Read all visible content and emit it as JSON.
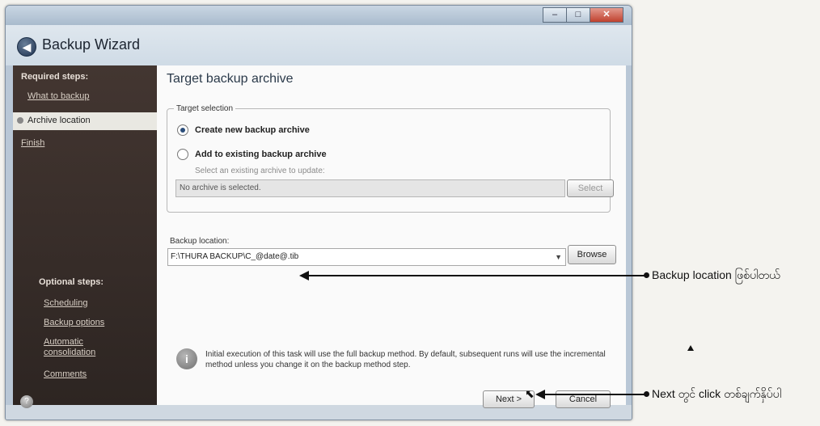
{
  "window": {
    "title": "Backup Wizard",
    "controls": {
      "minimize": "–",
      "maximize": "□",
      "close": "✕"
    }
  },
  "sidebar": {
    "required_heading": "Required steps:",
    "required_items": [
      "What to backup",
      "Archive location",
      "Finish"
    ],
    "active_item": "Archive location",
    "optional_heading": "Optional steps:",
    "optional_items": [
      "Scheduling",
      "Backup options",
      "Automatic",
      "consolidation",
      "Comments"
    ]
  },
  "main": {
    "title": "Target backup archive",
    "target_selection": {
      "legend": "Target selection",
      "option_new": "Create new backup archive",
      "option_existing": "Add to existing backup archive",
      "selected": "Create new backup archive",
      "hint": "Select an existing archive to update:",
      "archive_value": "No archive is selected.",
      "select_button": "Select"
    },
    "backup_location": {
      "label": "Backup location:",
      "value": "F:\\THURA BACKUP\\C_@date@.tib",
      "browse_button": "Browse"
    },
    "info_text": "Initial execution of this task will use the full backup method. By default, subsequent runs will use the incremental method unless you change it on the backup method step."
  },
  "footer": {
    "next_button": "Next >",
    "cancel_button": "Cancel"
  },
  "annotations": {
    "location_note": "Backup location ဖြစ်ပါတယ်",
    "next_note": "Next တွင် click တစ်ချက်နှိပ်ပါ"
  }
}
